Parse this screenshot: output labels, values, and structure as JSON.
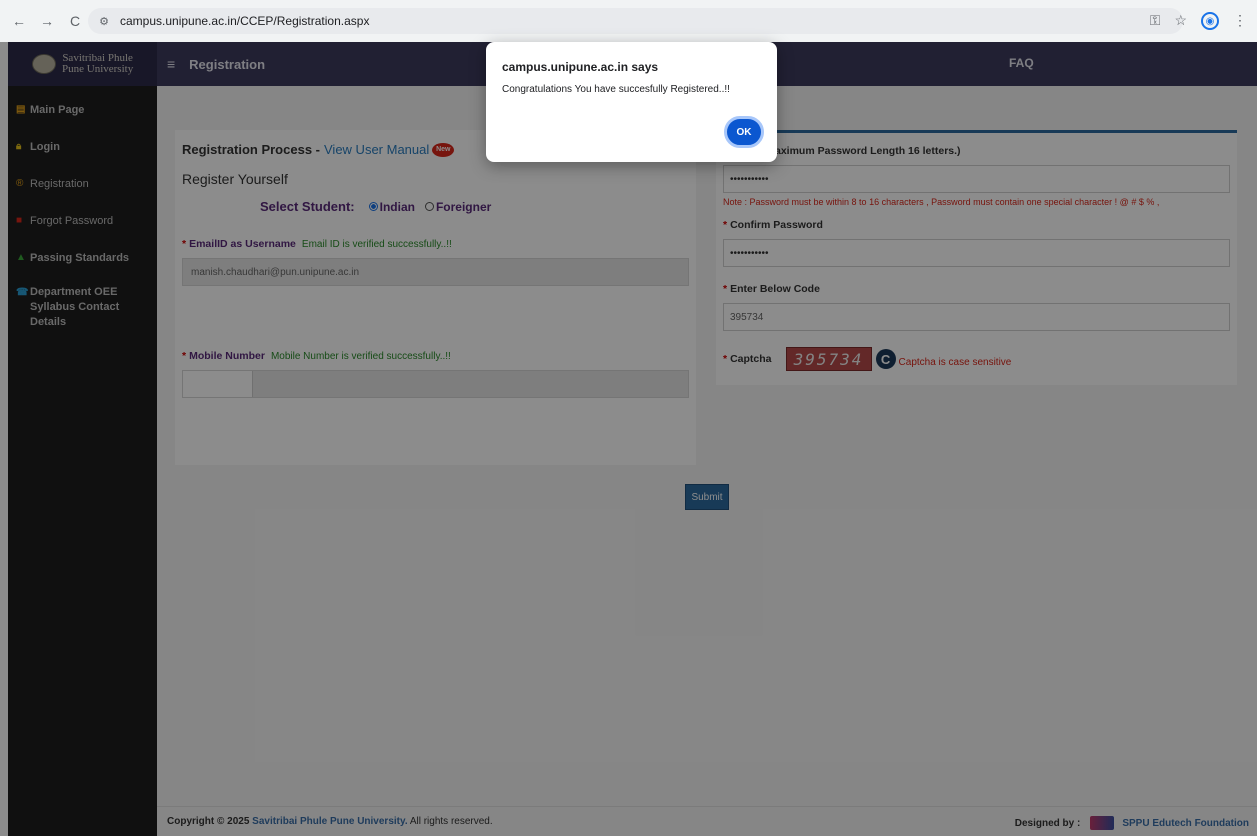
{
  "browser": {
    "back_icon": "←",
    "forward_icon": "→",
    "reload_icon": "C",
    "url": "campus.unipune.ac.in/CCEP/Registration.aspx"
  },
  "sidebar": {
    "logo_line1": "Savitribai Phule",
    "logo_line2": "Pune University",
    "items": [
      {
        "label": "Main Page",
        "icon": "grid-icon"
      },
      {
        "label": "Login",
        "icon": "lock-icon"
      },
      {
        "label": "Registration",
        "icon": "registered-icon"
      },
      {
        "label": "Forgot Password",
        "icon": "lock-icon"
      },
      {
        "label": "Passing Standards",
        "icon": "thumbs-up-icon"
      },
      {
        "label": "Department OEE Syllabus Contact Details",
        "icon": "phone-icon"
      }
    ]
  },
  "topnav": {
    "title": "Registration",
    "faq": "FAQ"
  },
  "form": {
    "heading": "Registration Process - ",
    "manual_link": "View User Manual",
    "new_badge": "New",
    "register_title": "Register Yourself",
    "select_student_label": "Select Student:",
    "option_indian": "Indian",
    "option_foreigner": "Foreigner",
    "email_label": "EmailID as Username",
    "email_verified": "Email ID is verified successfully..!!",
    "email_value": "manish.chaudhari@pun.unipune.ac.in",
    "mobile_label": "Mobile Number",
    "mobile_verified": "Mobile Number is verified successfully..!!",
    "password_label": "aximum Password Length 16 letters.)",
    "password_value": "•••••••••••",
    "password_note": "Note : Password must be within 8 to 16 characters , Password must contain one special character ! @ # $ % ,",
    "confirm_label": "Confirm Password",
    "confirm_value": "•••••••••••",
    "code_label": "Enter Below Code",
    "code_value": "395734",
    "captcha_label": "Captcha",
    "captcha_text": "395734",
    "captcha_note": "Captcha is case sensitive",
    "submit": "Submit"
  },
  "footer": {
    "copyright_prefix": "Copyright © 2025 ",
    "university": "Savitribai Phule Pune University.",
    "rights": " All rights reserved.",
    "designed_by": "Designed by :",
    "foundation": "SPPU Edutech Foundation"
  },
  "alert": {
    "title": "campus.unipune.ac.in says",
    "message": "Congratulations You have succesfully Registered..!!",
    "ok": "OK"
  }
}
